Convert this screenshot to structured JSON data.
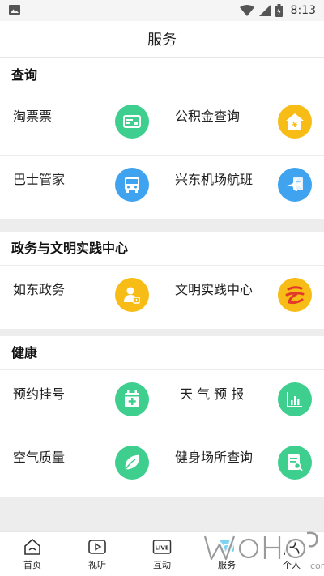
{
  "status_bar": {
    "time": "8:13"
  },
  "header": {
    "title": "服务"
  },
  "sections": [
    {
      "title": "查询",
      "rows": [
        [
          {
            "label": "淘票票",
            "icon": "ticket-card-icon",
            "color": "#3ecf8e"
          },
          {
            "label": "公积金查询",
            "icon": "house-yen-icon",
            "color": "#f7bd16"
          }
        ],
        [
          {
            "label": "巴士管家",
            "icon": "bus-icon",
            "color": "#3fa3ef"
          },
          {
            "label": "兴东机场航班",
            "icon": "airplane-icon",
            "color": "#3fa3ef"
          }
        ]
      ]
    },
    {
      "title": "政务与文明实践中心",
      "rows": [
        [
          {
            "label": "如东政务",
            "icon": "user-badge-icon",
            "color": "#f7bd16"
          },
          {
            "label": "文明实践中心",
            "icon": "civilization-logo-icon",
            "color": "#f7bd16"
          }
        ]
      ]
    },
    {
      "title": "健康",
      "rows": [
        [
          {
            "label": "预约挂号",
            "icon": "medical-calendar-icon",
            "color": "#3ecf8e"
          },
          {
            "label": "天 气 预 报",
            "icon": "bar-chart-icon",
            "color": "#3ecf8e"
          }
        ],
        [
          {
            "label": "空气质量",
            "icon": "leaf-icon",
            "color": "#3ecf8e"
          },
          {
            "label": "健身场所查询",
            "icon": "document-search-icon",
            "color": "#3ecf8e"
          }
        ]
      ]
    }
  ],
  "bottom_nav": [
    {
      "label": "首页",
      "icon": "home-icon"
    },
    {
      "label": "视听",
      "icon": "video-play-icon"
    },
    {
      "label": "互动",
      "icon": "live-icon"
    },
    {
      "label": "服务",
      "icon": "service-icon"
    },
    {
      "label": "个人",
      "icon": "person-icon"
    }
  ]
}
